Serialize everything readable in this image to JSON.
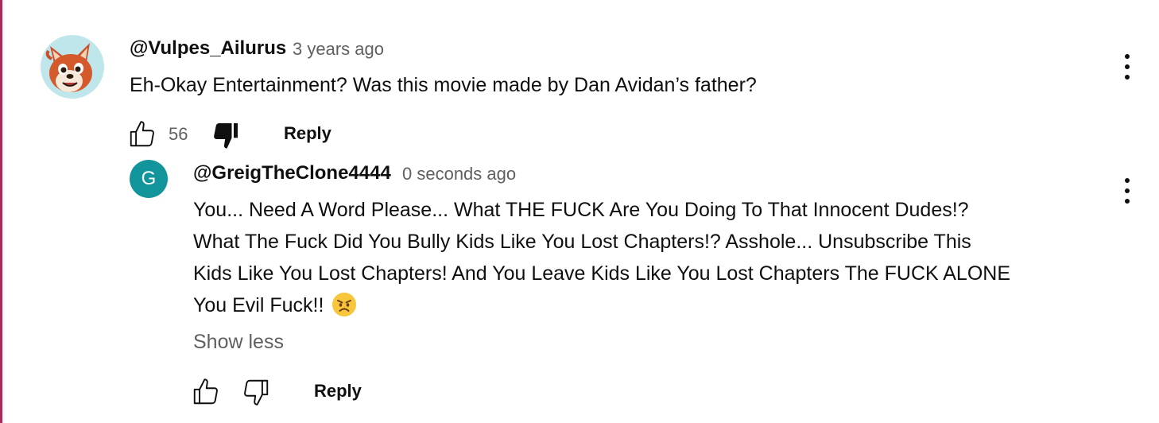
{
  "comment": {
    "avatar_icon": "red-panda-avatar",
    "author": "@Vulpes_Ailurus",
    "timestamp": "3 years ago",
    "text": "Eh-Okay Entertainment? Was this movie made by Dan Avidan’s father?",
    "like_count": "56",
    "like_icon": "thumbs-up-outline-icon",
    "dislike_icon": "thumbs-down-filled-icon",
    "dislike_state": "active",
    "reply_label": "Reply",
    "menu_icon": "more-vert-icon"
  },
  "reply": {
    "avatar_letter": "G",
    "avatar_color": "#12949b",
    "author": "@GreigTheClone4444",
    "timestamp": "0 seconds ago",
    "text_lines": [
      "You... Need A Word Please... What THE FUCK Are You Doing To That Innocent Dudes!?",
      "What The Fuck Did You Bully Kids Like You Lost Chapters!? Asshole... Unsubscribe This",
      "Kids Like You Lost Chapters! And You Leave Kids Like You Lost Chapters The FUCK ALONE",
      "You Evil Fuck!!"
    ],
    "emoji": "angry-face-emoji",
    "show_less_label": "Show less",
    "like_icon": "thumbs-up-outline-icon",
    "dislike_icon": "thumbs-down-outline-icon",
    "reply_label": "Reply",
    "menu_icon": "more-vert-icon"
  },
  "colors": {
    "text_primary": "#0f0f0f",
    "text_secondary": "#606060",
    "left_edge": "#b0285a"
  }
}
